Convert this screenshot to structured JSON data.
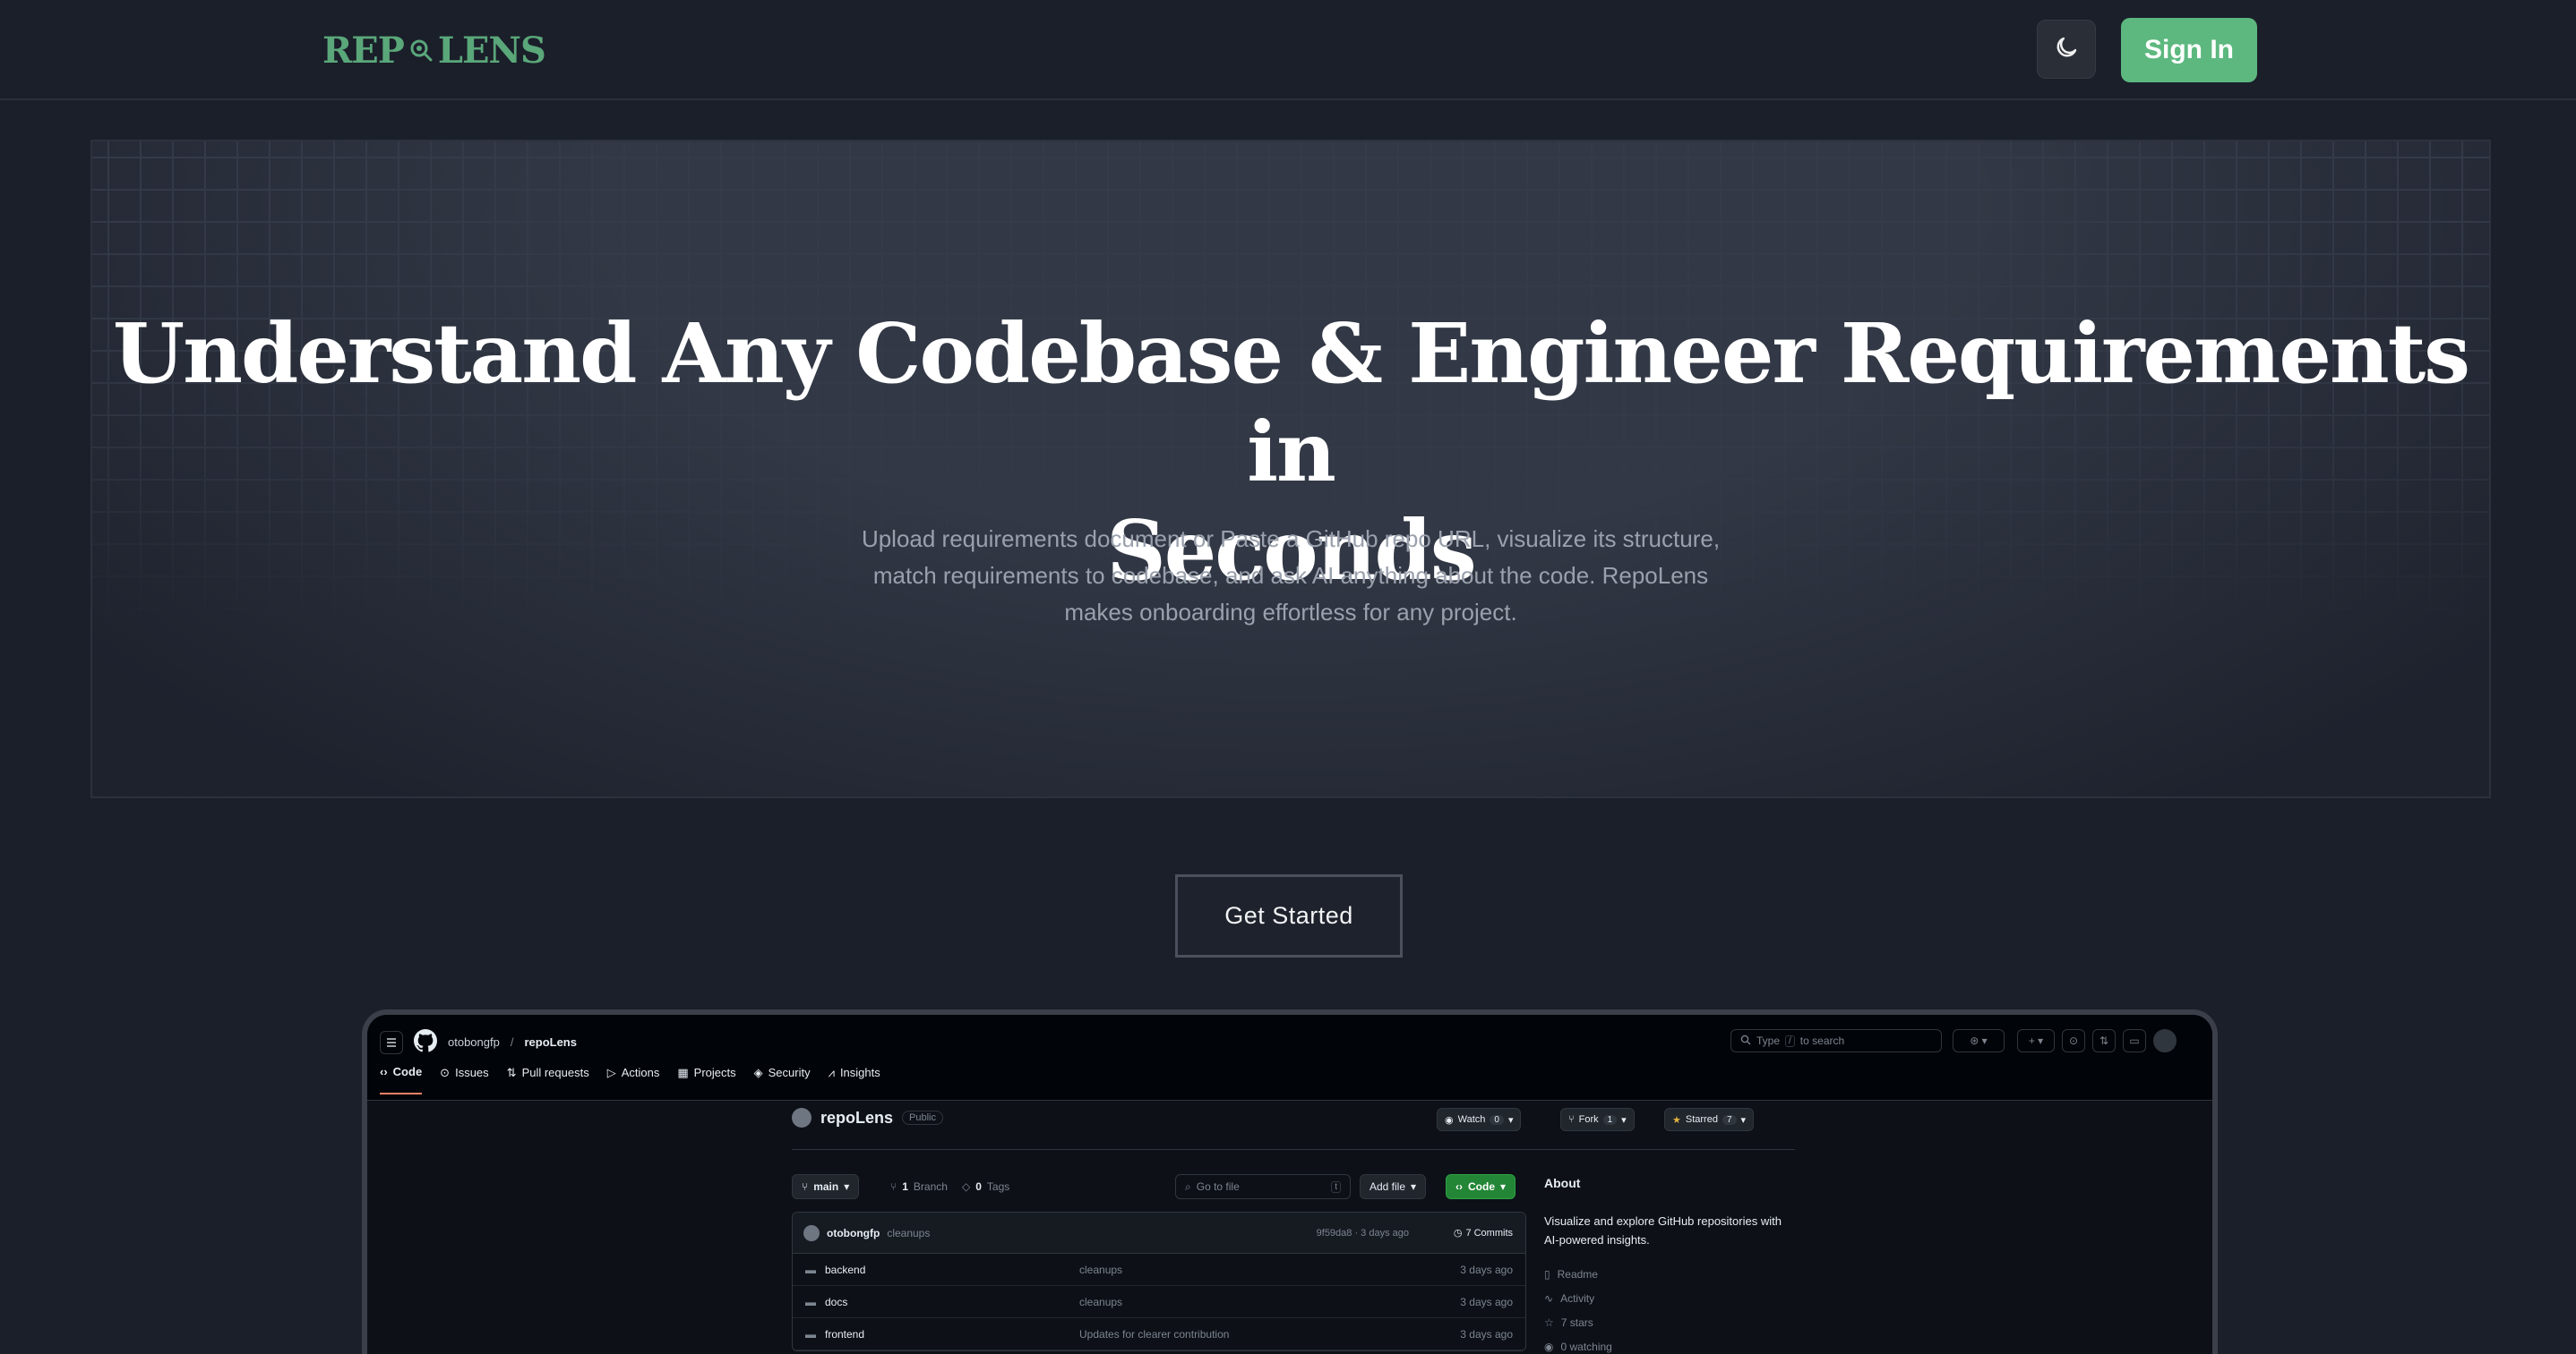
{
  "nav": {
    "logo_rep": "REP",
    "logo_lens": "LENS",
    "theme_icon": "moon-icon",
    "signin_label": "Sign In"
  },
  "hero": {
    "title_line1": "Understand Any Codebase & Engineer Requirements in",
    "title_line2": "Seconds",
    "sub_line1": "Upload requirements document or Paste a GitHub repo URL, visualize its structure,",
    "sub_line2": "match requirements to codebase, and ask AI anything about the code. RepoLens",
    "sub_line3": "makes onboarding effortless for any project."
  },
  "cta": {
    "label": "Get Started"
  },
  "github": {
    "owner": "otobongfp",
    "repo": "repoLens",
    "search_prefix": "Type",
    "search_key": "/",
    "search_suffix": "to search",
    "tabs": [
      "Code",
      "Issues",
      "Pull requests",
      "Actions",
      "Projects",
      "Security",
      "Insights"
    ],
    "visibility": "Public",
    "watch": {
      "label": "Watch",
      "count": "0"
    },
    "fork": {
      "label": "Fork",
      "count": "1"
    },
    "starred": {
      "label": "Starred",
      "count": "7"
    },
    "branch": "main",
    "branches_count": "1",
    "branches_label": "Branch",
    "tags_count": "0",
    "tags_label": "Tags",
    "go_to_file": "Go to file",
    "go_to_file_key": "t",
    "add_file": "Add file",
    "code_button": "Code",
    "commit": {
      "author": "otobongfp",
      "message": "cleanups",
      "meta": "9f59da8 · 3 days ago",
      "commits": "7 Commits"
    },
    "files": [
      {
        "name": "backend",
        "message": "cleanups",
        "time": "3 days ago"
      },
      {
        "name": "docs",
        "message": "cleanups",
        "time": "3 days ago"
      },
      {
        "name": "frontend",
        "message": "Updates for clearer contribution",
        "time": "3 days ago"
      }
    ],
    "about": {
      "heading": "About",
      "description": "Visualize and explore GitHub repositories with AI-powered insights.",
      "readme": "Readme",
      "activity": "Activity",
      "stars": "7 stars",
      "watching": "0 watching"
    }
  },
  "colors": {
    "background": "#1b1f2a",
    "brand_green": "#5cb87f",
    "logo_green": "#5aa77a",
    "github_bg": "#0d1117",
    "github_code_green": "#238636"
  }
}
